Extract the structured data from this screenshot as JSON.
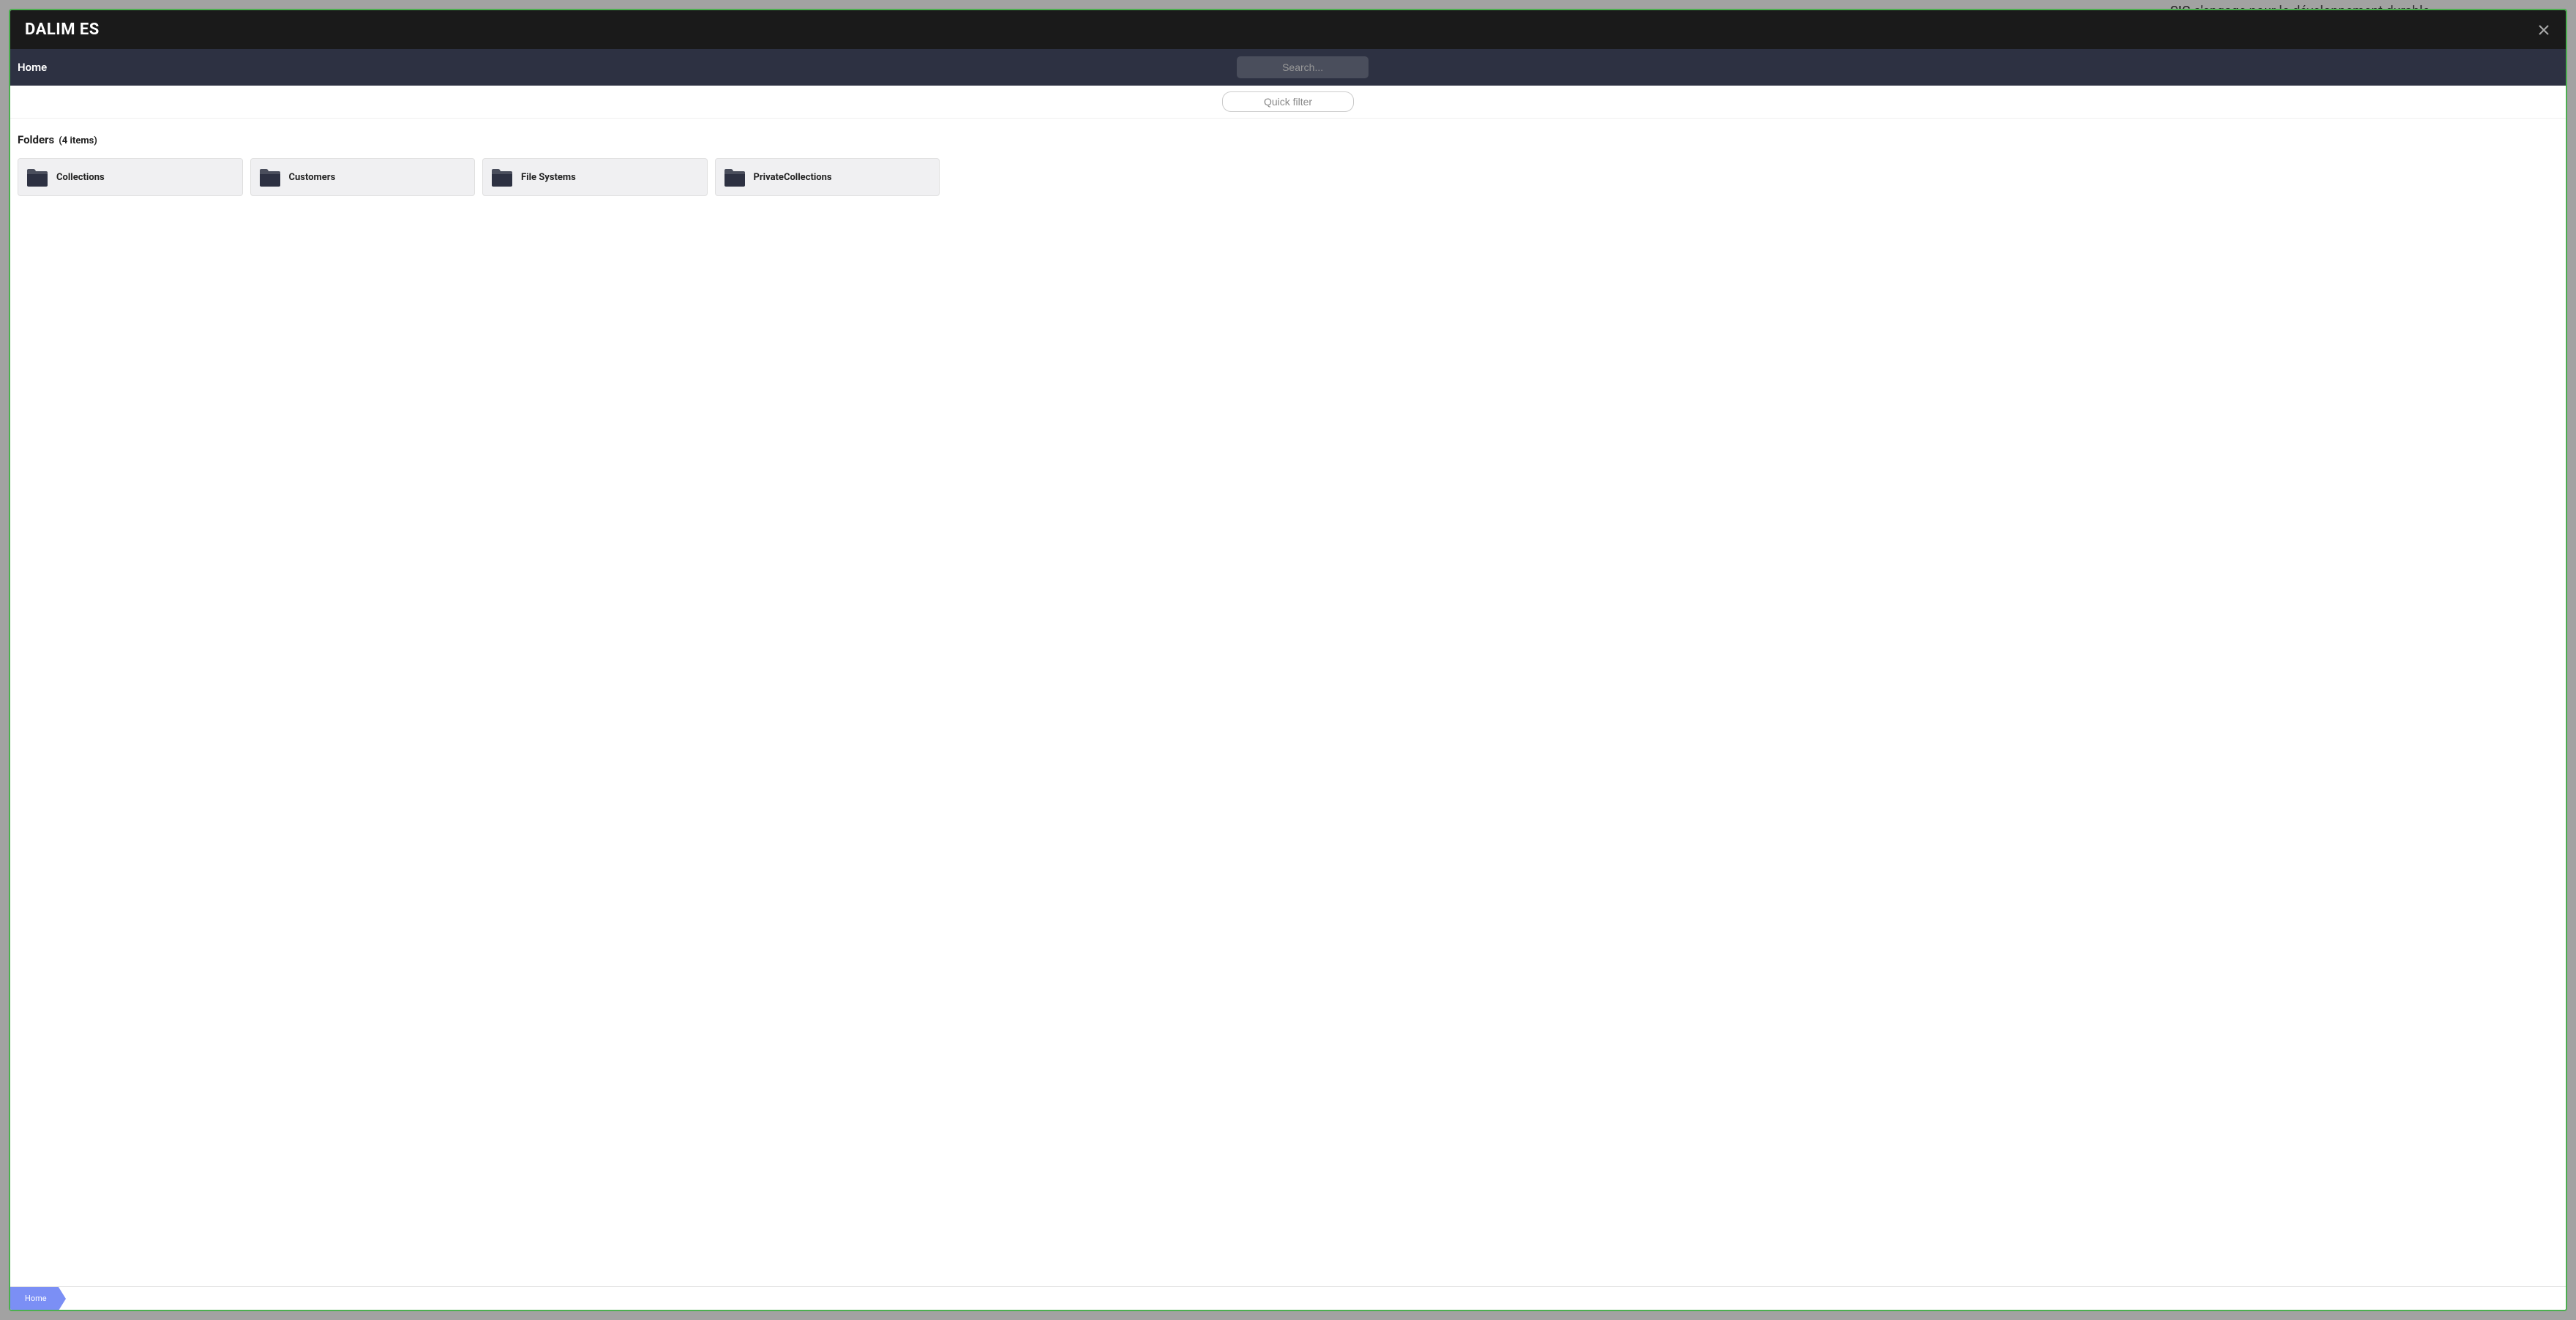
{
  "background": {
    "left_text": "",
    "right_text": "SIG s'engage pour le développement durable"
  },
  "modal": {
    "title": "DALIM ES",
    "nav": {
      "home_label": "Home"
    },
    "search": {
      "placeholder": "Search..."
    },
    "filter": {
      "placeholder": "Quick filter"
    },
    "section": {
      "title": "Folders",
      "count": "(4 items)"
    },
    "folders": [
      {
        "name": "Collections"
      },
      {
        "name": "Customers"
      },
      {
        "name": "File Systems"
      },
      {
        "name": "PrivateCollections"
      }
    ],
    "breadcrumb": {
      "home": "Home"
    }
  }
}
